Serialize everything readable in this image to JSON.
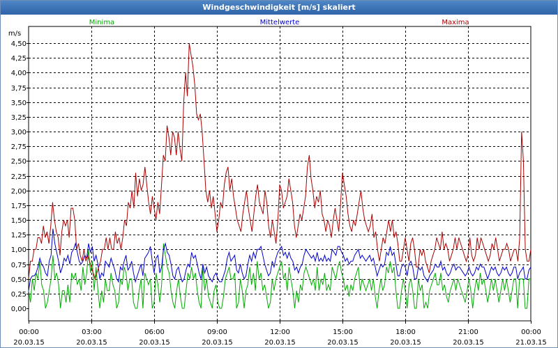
{
  "window": {
    "title": "Windgeschwindigkeit [m/s] skaliert"
  },
  "chart_data": {
    "type": "line",
    "title": "Windgeschwindigkeit [m/s] skaliert",
    "ylabel": "m/s",
    "ylim": [
      0,
      4.5
    ],
    "xlim": [
      0,
      96
    ],
    "yticks": [
      "0,00",
      "0,25",
      "0,50",
      "0,75",
      "1,00",
      "1,25",
      "1,50",
      "1,75",
      "2,00",
      "2,25",
      "2,50",
      "2,75",
      "3,00",
      "3,25",
      "3,50",
      "3,75",
      "4,00",
      "4,25",
      "4,50"
    ],
    "xticks": [
      {
        "time": "00:00",
        "date": "20.03.15"
      },
      {
        "time": "03:00",
        "date": "20.03.15"
      },
      {
        "time": "06:00",
        "date": "20.03.15"
      },
      {
        "time": "09:00",
        "date": "20.03.15"
      },
      {
        "time": "12:00",
        "date": "20.03.15"
      },
      {
        "time": "15:00",
        "date": "20.03.15"
      },
      {
        "time": "18:00",
        "date": "20.03.15"
      },
      {
        "time": "21:00",
        "date": "20.03.15"
      },
      {
        "time": "00:00",
        "date": "21.03.15"
      }
    ],
    "grid": true,
    "x_time_step": "15 min",
    "series": [
      {
        "name": "Minima",
        "color": "#00aa00",
        "values": [
          0.3,
          0.1,
          0.5,
          0.3,
          0.6,
          0.5,
          0.8,
          0.4,
          0.3,
          0.0,
          0.1,
          0.3,
          0.5,
          0.9,
          0.5,
          0.6,
          0.4,
          0.0,
          0.3,
          0.3,
          0.1,
          0.4,
          0.1,
          0.6,
          0.5,
          0.6,
          0.4,
          0.5,
          0.3,
          0.7,
          0.4,
          0.6,
          1.0,
          0.6,
          0.8,
          0.3,
          0.7,
          0.3,
          0.0,
          0.3,
          0.1,
          0.5,
          0.3,
          0.3,
          0.6,
          0.4,
          0.3,
          0.0,
          0.1,
          0.5,
          0.4,
          0.7,
          0.6,
          0.3,
          0.5,
          0.5,
          0.1,
          0.0,
          0.0,
          0.3,
          0.5,
          0.0,
          0.6,
          0.5,
          0.4,
          0.5,
          0.0,
          0.1,
          0.6,
          0.4,
          0.1,
          0.4,
          1.1,
          0.9,
          0.7,
          0.6,
          0.3,
          0.1,
          0.0,
          0.3,
          0.5,
          0.2,
          0.0,
          0.0,
          0.3,
          0.6,
          0.5,
          0.7,
          0.5,
          0.6,
          0.3,
          0.1,
          0.0,
          0.7,
          0.3,
          0.5,
          0.2,
          0.1,
          0.0,
          0.3,
          0.4,
          0.1,
          0.0,
          0.0,
          0.2,
          0.5,
          0.6,
          0.7,
          0.5,
          0.5,
          0.6,
          0.0,
          0.1,
          0.5,
          0.3,
          0.0,
          0.3,
          0.4,
          0.7,
          0.4,
          0.6,
          0.3,
          0.8,
          0.5,
          0.6,
          0.3,
          0.4,
          0.2,
          0.0,
          0.1,
          0.5,
          0.3,
          0.5,
          0.6,
          0.7,
          0.8,
          0.5,
          0.6,
          0.3,
          0.7,
          0.5,
          0.3,
          0.0,
          0.3,
          0.1,
          0.4,
          0.3,
          0.6,
          0.7,
          0.6,
          0.5,
          0.4,
          0.5,
          0.3,
          0.7,
          0.3,
          0.5,
          0.4,
          0.6,
          0.3,
          0.4,
          0.3,
          0.7,
          0.6,
          0.5,
          0.7,
          0.8,
          0.6,
          0.5,
          0.3,
          0.4,
          0.2,
          0.4,
          0.3,
          0.5,
          0.6,
          0.7,
          0.3,
          0.5,
          0.4,
          0.3,
          0.4,
          0.5,
          0.3,
          0.5,
          0.2,
          0.0,
          0.3,
          0.5,
          0.3,
          0.4,
          0.7,
          0.6,
          0.8,
          0.6,
          0.7,
          0.3,
          0.0,
          0.0,
          0.3,
          0.5,
          0.3,
          0.0,
          0.4,
          0.5,
          0.3,
          0.0,
          0.0,
          0.5,
          0.3,
          0.4,
          0.0,
          0.1,
          0.0,
          0.3,
          0.4,
          0.5,
          0.6,
          0.4,
          0.4,
          0.6,
          0.3,
          0.4,
          0.2,
          0.1,
          0.3,
          0.4,
          0.5,
          0.3,
          0.5,
          0.4,
          0.3,
          0.2,
          0.1,
          0.3,
          0.5,
          0.3,
          0.0,
          0.3,
          0.5,
          0.3,
          0.6,
          0.4,
          0.5,
          0.3,
          0.1,
          0.3,
          0.5,
          0.3,
          0.5,
          0.3,
          0.1,
          0.3,
          0.5,
          0.3,
          0.5,
          0.3,
          0.1,
          0.3,
          0.5,
          0.5,
          0.0,
          0.5,
          0.5,
          0.5,
          0.0,
          0.0,
          0.5,
          0.5
        ]
      },
      {
        "name": "Mittelwerte",
        "color": "#0000cc",
        "values": [
          0.3,
          0.5,
          0.55,
          0.55,
          0.6,
          0.7,
          0.85,
          0.75,
          0.7,
          0.6,
          0.55,
          0.8,
          0.9,
          1.35,
          1.1,
          0.95,
          0.8,
          0.6,
          0.7,
          0.85,
          0.8,
          0.9,
          0.75,
          0.95,
          1.0,
          1.1,
          0.95,
          0.8,
          0.75,
          0.8,
          0.9,
          0.85,
          1.1,
          0.95,
          1.05,
          0.8,
          0.9,
          0.75,
          0.5,
          0.6,
          0.55,
          0.8,
          0.75,
          0.7,
          0.85,
          0.75,
          0.65,
          0.5,
          0.45,
          0.7,
          0.65,
          0.8,
          0.9,
          0.65,
          0.7,
          0.8,
          0.6,
          0.45,
          0.55,
          0.65,
          0.75,
          0.55,
          0.85,
          0.9,
          0.95,
          1.05,
          0.8,
          0.6,
          0.85,
          0.9,
          0.6,
          0.7,
          1.0,
          1.1,
          0.95,
          0.9,
          0.75,
          0.55,
          0.5,
          0.65,
          0.7,
          0.55,
          0.45,
          0.5,
          0.65,
          0.75,
          0.7,
          0.95,
          0.85,
          0.9,
          0.75,
          0.6,
          0.5,
          0.75,
          0.6,
          0.7,
          0.55,
          0.5,
          0.45,
          0.55,
          0.6,
          0.5,
          0.45,
          0.45,
          0.55,
          0.65,
          0.85,
          0.95,
          0.8,
          0.85,
          0.9,
          0.65,
          0.6,
          0.75,
          0.6,
          0.5,
          0.55,
          0.75,
          0.9,
          0.8,
          0.95,
          0.85,
          1.0,
          1.0,
          1.05,
          0.9,
          0.75,
          0.65,
          0.55,
          0.6,
          0.8,
          0.7,
          0.85,
          0.95,
          1.0,
          1.05,
          0.9,
          0.95,
          0.85,
          0.95,
          0.85,
          0.8,
          0.65,
          0.7,
          0.6,
          0.7,
          0.75,
          0.9,
          1.0,
          0.95,
          0.9,
          0.85,
          0.9,
          0.8,
          0.95,
          0.8,
          0.85,
          0.8,
          0.9,
          0.8,
          0.85,
          0.8,
          1.0,
          0.95,
          0.9,
          1.05,
          1.05,
          0.95,
          0.9,
          0.8,
          0.85,
          0.75,
          0.8,
          0.8,
          0.9,
          0.95,
          1.0,
          0.85,
          0.9,
          0.85,
          0.8,
          0.85,
          0.9,
          0.8,
          0.85,
          0.7,
          0.55,
          0.65,
          0.75,
          0.7,
          0.75,
          0.95,
          0.9,
          1.05,
          0.9,
          0.95,
          0.75,
          0.55,
          0.55,
          0.7,
          0.75,
          0.7,
          0.55,
          0.75,
          0.8,
          0.7,
          0.5,
          0.5,
          0.7,
          0.65,
          0.7,
          0.55,
          0.5,
          0.45,
          0.55,
          0.6,
          0.65,
          0.75,
          0.7,
          0.7,
          0.8,
          0.65,
          0.7,
          0.6,
          0.55,
          0.6,
          0.7,
          0.75,
          0.65,
          0.7,
          0.7,
          0.65,
          0.6,
          0.55,
          0.6,
          0.7,
          0.6,
          0.55,
          0.6,
          0.7,
          0.65,
          0.75,
          0.7,
          0.7,
          0.6,
          0.5,
          0.6,
          0.7,
          0.65,
          0.7,
          0.6,
          0.55,
          0.6,
          0.7,
          0.65,
          0.7,
          0.6,
          0.55,
          0.6,
          0.7,
          0.7,
          0.5,
          0.6,
          0.65,
          0.7,
          0.5,
          0.5,
          0.65,
          0.7
        ]
      },
      {
        "name": "Maxima",
        "color": "#aa0000",
        "values": [
          0.5,
          0.8,
          0.8,
          1.0,
          1.0,
          1.2,
          1.2,
          1.1,
          1.4,
          1.2,
          1.3,
          1.1,
          1.4,
          1.8,
          1.5,
          1.3,
          1.2,
          0.9,
          1.3,
          1.5,
          1.4,
          1.5,
          1.2,
          1.7,
          1.7,
          1.5,
          1.0,
          1.1,
          0.9,
          0.8,
          1.0,
          0.8,
          0.9,
          0.8,
          0.7,
          0.6,
          0.5,
          0.6,
          0.7,
          0.8,
          1.0,
          1.0,
          1.2,
          1.0,
          1.2,
          1.0,
          1.0,
          1.3,
          1.1,
          1.2,
          1.0,
          1.2,
          1.5,
          1.4,
          1.8,
          1.7,
          2.0,
          1.7,
          2.3,
          1.9,
          2.2,
          2.0,
          2.1,
          2.4,
          2.1,
          1.8,
          1.6,
          1.9,
          1.7,
          1.5,
          1.8,
          1.6,
          2.1,
          2.6,
          2.5,
          3.1,
          2.9,
          2.6,
          3.0,
          2.9,
          2.6,
          3.0,
          2.7,
          2.5,
          3.5,
          4.0,
          3.6,
          4.5,
          4.3,
          4.1,
          3.8,
          3.3,
          3.2,
          3.3,
          3.0,
          2.5,
          2.0,
          1.8,
          2.0,
          1.7,
          1.9,
          1.6,
          1.3,
          1.5,
          1.8,
          1.7,
          2.1,
          2.3,
          2.4,
          2.0,
          2.2,
          1.9,
          1.7,
          1.5,
          1.4,
          1.3,
          1.6,
          1.8,
          2.0,
          1.7,
          1.5,
          1.3,
          1.6,
          1.9,
          2.1,
          1.8,
          1.7,
          1.6,
          2.0,
          1.8,
          1.4,
          1.2,
          1.5,
          1.3,
          1.1,
          1.5,
          2.1,
          2.0,
          1.7,
          1.8,
          1.9,
          2.2,
          2.0,
          1.8,
          1.4,
          1.2,
          1.4,
          1.6,
          1.5,
          1.7,
          1.9,
          2.4,
          2.6,
          2.2,
          2.0,
          1.7,
          1.9,
          1.8,
          2.0,
          1.6,
          1.5,
          1.3,
          1.5,
          1.4,
          1.2,
          1.5,
          1.7,
          1.5,
          1.3,
          1.8,
          2.3,
          2.1,
          1.9,
          1.6,
          1.4,
          1.3,
          1.5,
          1.4,
          1.6,
          1.8,
          2.0,
          1.7,
          1.5,
          1.4,
          1.3,
          1.4,
          1.6,
          1.2,
          1.3,
          1.0,
          0.8,
          1.0,
          1.2,
          1.1,
          1.3,
          1.5,
          1.3,
          1.5,
          1.2,
          1.3,
          1.1,
          0.8,
          0.8,
          1.0,
          1.2,
          1.0,
          0.8,
          1.1,
          1.2,
          1.0,
          0.7,
          0.7,
          1.0,
          0.9,
          1.0,
          0.8,
          0.7,
          0.6,
          0.8,
          0.9,
          1.0,
          1.2,
          1.1,
          1.0,
          1.3,
          1.0,
          1.1,
          1.0,
          0.8,
          0.9,
          1.0,
          1.2,
          1.0,
          1.2,
          1.1,
          1.0,
          0.9,
          0.8,
          0.9,
          1.2,
          0.9,
          0.8,
          0.9,
          1.2,
          1.0,
          1.2,
          1.1,
          1.0,
          0.9,
          0.8,
          0.9,
          1.1,
          1.0,
          1.2,
          1.0,
          0.8,
          0.9,
          1.0,
          1.0,
          1.1,
          1.0,
          0.8,
          0.9,
          1.0,
          1.0,
          0.8,
          1.2,
          3.0,
          2.5,
          1.0,
          0.8,
          0.8,
          1.0
        ]
      }
    ]
  }
}
